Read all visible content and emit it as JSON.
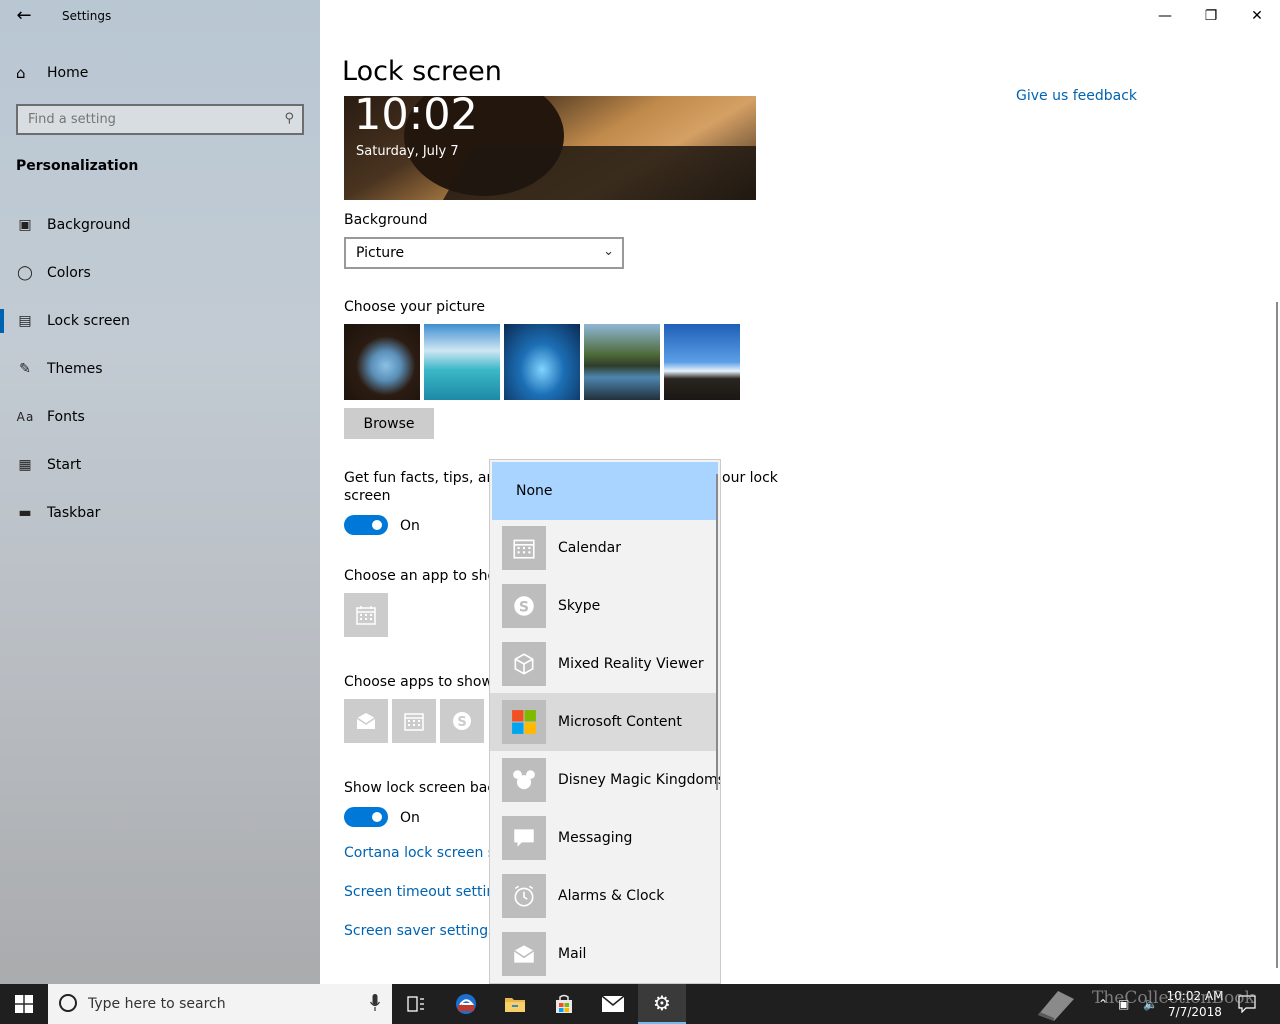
{
  "window": {
    "title": "Settings"
  },
  "sidebar": {
    "home_label": "Home",
    "search_placeholder": "Find a setting",
    "section_title": "Personalization",
    "items": [
      {
        "label": "Background",
        "icon": "picture-icon"
      },
      {
        "label": "Colors",
        "icon": "palette-icon"
      },
      {
        "label": "Lock screen",
        "icon": "lock-screen-icon",
        "active": true
      },
      {
        "label": "Themes",
        "icon": "themes-icon"
      },
      {
        "label": "Fonts",
        "icon": "fonts-icon"
      },
      {
        "label": "Start",
        "icon": "start-icon"
      },
      {
        "label": "Taskbar",
        "icon": "taskbar-icon"
      }
    ]
  },
  "main": {
    "title": "Lock screen",
    "feedback_link": "Give us feedback",
    "preview": {
      "time": "10:02",
      "date": "Saturday, July 7"
    },
    "background_label": "Background",
    "background_value": "Picture",
    "choose_picture_label": "Choose your picture",
    "browse_label": "Browse",
    "fun_facts_label_a": "Get fun facts, tips, and m",
    "fun_facts_label_b": "our lock",
    "fun_facts_label_c": "screen",
    "fun_facts_toggle": "On",
    "detailed_status_label": "Choose an app to show",
    "quick_status_label": "Choose apps to show q",
    "show_bg_label": "Show lock screen backg",
    "show_bg_toggle": "On",
    "cortana_link": "Cortana lock screen set",
    "timeout_link": "Screen timeout settings",
    "saver_link": "Screen saver settings"
  },
  "dropdown": {
    "items": [
      {
        "label": "None",
        "selected": true
      },
      {
        "label": "Calendar",
        "icon": "calendar-icon"
      },
      {
        "label": "Skype",
        "icon": "skype-icon"
      },
      {
        "label": "Mixed Reality Viewer",
        "icon": "cube-icon"
      },
      {
        "label": "Microsoft Content",
        "icon": "microsoft-logo-icon",
        "hover": true
      },
      {
        "label": "Disney Magic Kingdoms",
        "icon": "mickey-icon"
      },
      {
        "label": "Messaging",
        "icon": "chat-bubble-icon"
      },
      {
        "label": "Alarms & Clock",
        "icon": "clock-icon"
      },
      {
        "label": "Mail",
        "icon": "mail-icon"
      }
    ]
  },
  "taskbar": {
    "search_placeholder": "Type here to search",
    "clock_time": "10:02 AM",
    "clock_date": "7/7/2018",
    "watermark": "TheCollectionBook"
  },
  "colors": {
    "accent": "#0078d7",
    "link": "#0063b1",
    "selection": "#a8d4ff"
  }
}
